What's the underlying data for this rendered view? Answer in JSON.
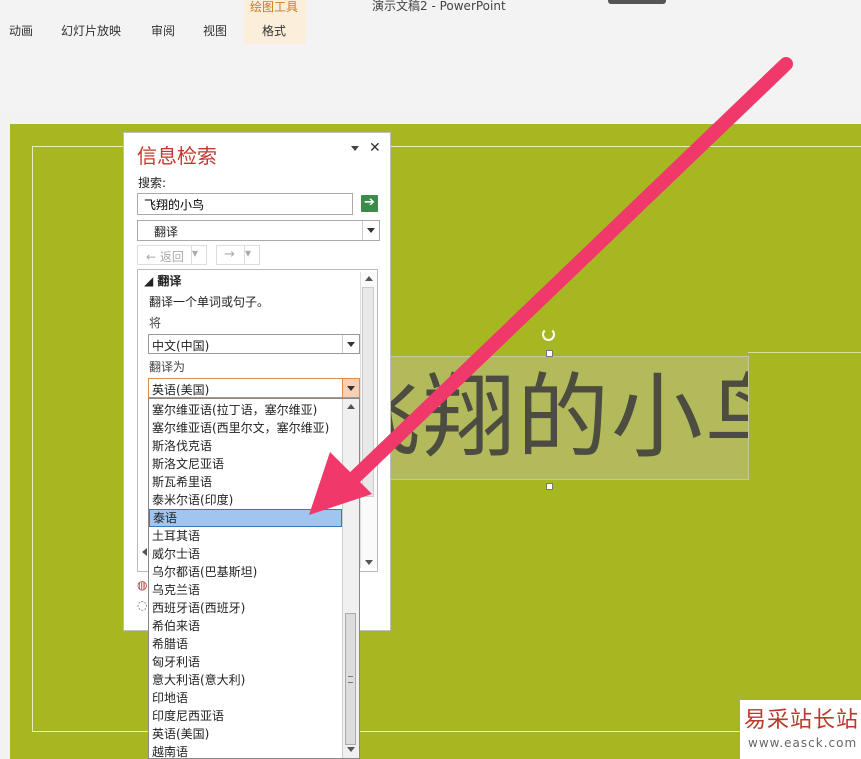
{
  "ribbon": {
    "tabs": [
      "动画",
      "幻灯片放映",
      "审阅",
      "视图"
    ],
    "context_group_label": "绘图工具",
    "context_tab": "格式",
    "window_title": "演示文稿2 - PowerPoint"
  },
  "slide": {
    "title_text": "飞翔的小鸟"
  },
  "pane": {
    "title": "信息检索",
    "search_label": "搜索:",
    "search_value": "飞翔的小鸟",
    "service_value": "翻译",
    "back_label": "返回",
    "section_title": "翻译",
    "section_desc": "翻译一个单词或句子。",
    "from_label": "将",
    "from_value": "中文(中国)",
    "to_label": "翻译为",
    "to_value": "英语(美国)"
  },
  "dropdown": {
    "options": [
      "塞尔维亚语(拉丁语，塞尔维亚)",
      "塞尔维亚语(西里尔文，塞尔维亚)",
      "斯洛伐克语",
      "斯洛文尼亚语",
      "斯瓦希里语",
      "泰米尔语(印度)",
      "泰语",
      "土耳其语",
      "威尔士语",
      "乌尔都语(巴基斯坦)",
      "乌克兰语",
      "西班牙语(西班牙)",
      "希伯来语",
      "希腊语",
      "匈牙利语",
      "意大利语(意大利)",
      "印地语",
      "印度尼西亚语",
      "英语(美国)",
      "越南语"
    ],
    "selected": "泰语"
  },
  "watermark": {
    "logo": "易采站长站",
    "url": "www.easck.com"
  },
  "colors": {
    "slide_bg": "#a7b722",
    "pane_title": "#c0392b",
    "arrow": "#f0386a",
    "selection": "#9ec6f0"
  }
}
